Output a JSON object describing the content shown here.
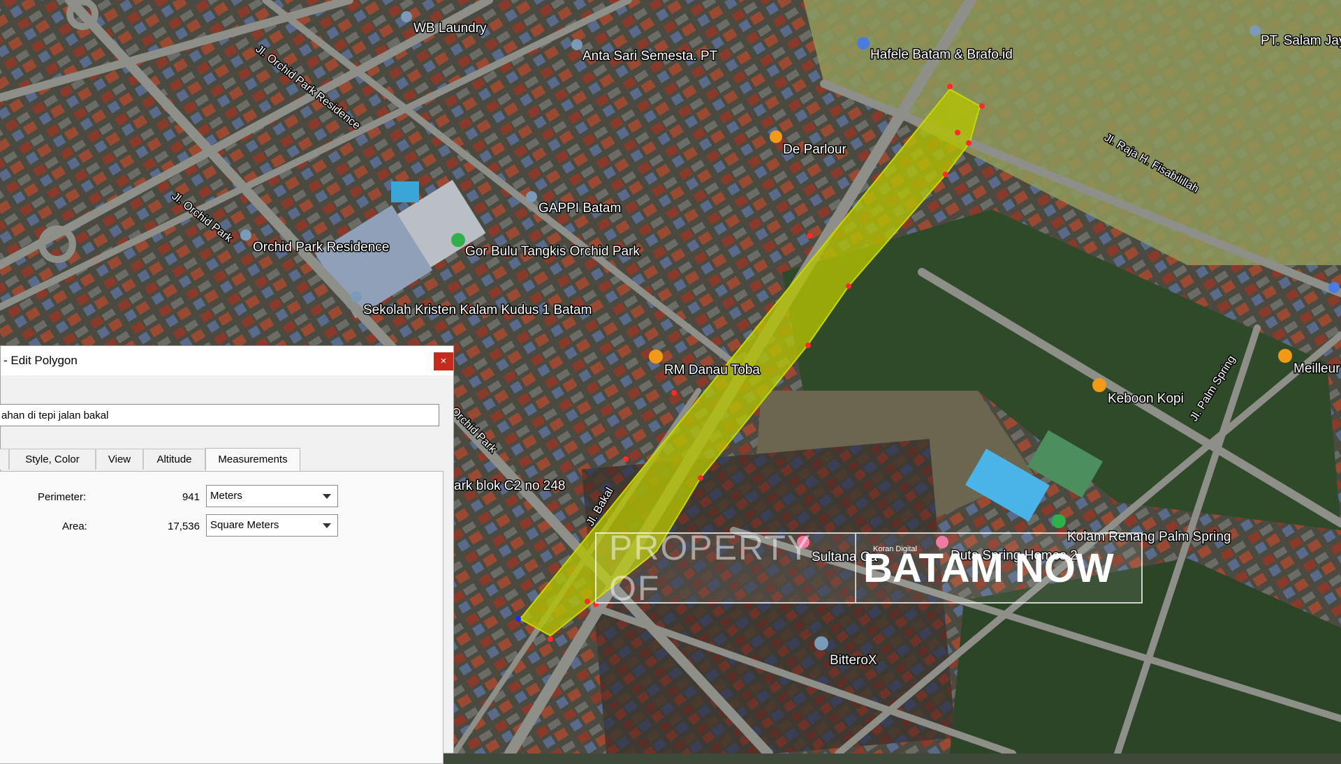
{
  "map": {
    "pois": [
      {
        "label": "WB Laundry",
        "icon": "pin-gray-icon"
      },
      {
        "label": "Anta Sari Semesta. PT",
        "icon": "pin-gray-icon"
      },
      {
        "label": "Hafele Batam & Brafo.id",
        "icon": "pin-blue-icon"
      },
      {
        "label": "PT. Salam Jaya",
        "icon": "pin-gray-icon"
      },
      {
        "label": "De Parlour",
        "icon": "pin-orange-icon"
      },
      {
        "label": "GAPPI Batam",
        "icon": "pin-gray-icon"
      },
      {
        "label": "Orchid Park Residence",
        "icon": "pin-gray-icon"
      },
      {
        "label": "Gor Bulu Tangkis Orchid Park",
        "icon": "pin-green-icon"
      },
      {
        "label": "Sekolah Kristen Kalam Kudus 1 Batam",
        "icon": "pin-gray-icon"
      },
      {
        "label": "RM Danau Toba",
        "icon": "pin-orange-icon"
      },
      {
        "label": "Keboon Kopi",
        "icon": "pin-orange-icon"
      },
      {
        "label": "Meilleur",
        "icon": "pin-orange-icon"
      },
      {
        "label": "Kolam Renang Palm Spring",
        "icon": "pin-green-icon"
      },
      {
        "label": "Sultana Ca",
        "icon": "pin-pink-icon"
      },
      {
        "label": "Duta Spring Homes 2",
        "icon": "pin-pink-icon"
      },
      {
        "label": "BitteroX",
        "icon": "pin-gray-icon"
      },
      {
        "label": "ark blok C2 no 248",
        "icon": ""
      }
    ],
    "roads": [
      "Jl. Orchid Park Residence",
      "Jl. Orchid Park",
      "Jl. Raja H. Fisabilillah",
      "Jl. Palm Spring",
      "Jl. Bakal",
      "Orchid Park"
    ],
    "small_label": "Koran Digital",
    "polygon_fill": "#b5c400",
    "vertex_color": "#ff2a2a",
    "selected_vertex_color": "#1a2cff"
  },
  "watermark": {
    "left": "PROPERTY OF",
    "right": "BATAM NOW"
  },
  "dialog": {
    "title": "- Edit Polygon",
    "close": "×",
    "name_value": "ahan di tepi jalan bakal",
    "tabs": [
      "Style, Color",
      "View",
      "Altitude",
      "Measurements"
    ],
    "active_tab": "Measurements",
    "measurements": {
      "perimeter_label": "Perimeter:",
      "perimeter_value": "941",
      "perimeter_unit": "Meters",
      "area_label": "Area:",
      "area_value": "17,536",
      "area_unit": "Square Meters"
    }
  }
}
